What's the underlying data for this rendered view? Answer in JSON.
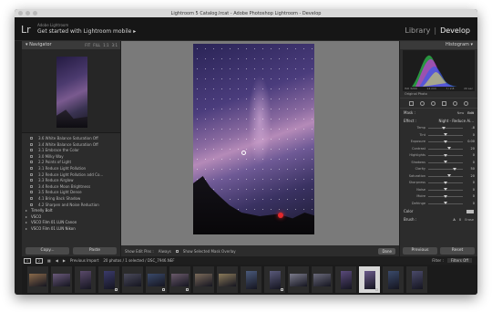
{
  "window": {
    "title": "Lightroom 5 Catalog.lrcat - Adobe Photoshop Lightroom - Develop"
  },
  "identity": {
    "small": "Adobe Lightroom",
    "main": "Get started with Lightroom mobile  ▸"
  },
  "modules": [
    "Library",
    "|",
    "Develop"
  ],
  "navigator": {
    "title": "Navigator",
    "zoom": [
      "FIT",
      "FILL",
      "1:1",
      "3:1"
    ]
  },
  "history": [
    {
      "label": "3.6 White Balance Saturation Off"
    },
    {
      "label": "3.4 White Balance Saturation Off"
    },
    {
      "label": "3.1 Embrace the Color"
    },
    {
      "label": "3.0 Milky Way"
    },
    {
      "label": "2.2 Points of Light"
    },
    {
      "label": "3.1 Reduce Light Pollution"
    },
    {
      "label": "3.2 Reduce Light Pollution add Co..."
    },
    {
      "label": "3.3 Reduce Airglow"
    },
    {
      "label": "3.4 Reduce Moon Brightness"
    },
    {
      "label": "3.5 Reduce Light Dense"
    },
    {
      "label": "4.1 Bring Back Shadow"
    },
    {
      "label": "4.2 Sharpen and Noise Reduction"
    }
  ],
  "collections": [
    "Timelly Bolt",
    "VSCO",
    "VSCO Film 01 LUN Canon",
    "VSCO Film 01 LUN Nikon"
  ],
  "left_buttons": {
    "copy": "Copy...",
    "paste": "Paste"
  },
  "toolbar": {
    "show_edit_pins": "Show Edit Pins :",
    "pins_value": "Always",
    "show_overlay": "Show Selected Mask Overlay",
    "done": "Done"
  },
  "histogram": {
    "title": "Histogram",
    "values": [
      "ISO 3200",
      "14 mm",
      "f / 2.8",
      "20 sec"
    ],
    "original_photo": "Original Photo"
  },
  "basic": {
    "mask": "Mask :",
    "new": "New",
    "edit": "Edit",
    "effect": "Effect :",
    "effect_value": "Night - Reduce Ai...",
    "sliders": [
      {
        "label": "Temp",
        "value": "-8",
        "pos": 0.45
      },
      {
        "label": "Tint",
        "value": "0",
        "pos": 0.5
      },
      {
        "label": "Exposure",
        "value": "0.00",
        "pos": 0.5
      },
      {
        "label": "Contrast",
        "value": "20",
        "pos": 0.6
      },
      {
        "label": "Highlights",
        "value": "0",
        "pos": 0.5
      },
      {
        "label": "Shadows",
        "value": "0",
        "pos": 0.5
      },
      {
        "label": "Clarity",
        "value": "50",
        "pos": 0.75
      },
      {
        "label": "Saturation",
        "value": "20",
        "pos": 0.6
      },
      {
        "label": "Sharpness",
        "value": "0",
        "pos": 0.5
      },
      {
        "label": "Noise",
        "value": "0",
        "pos": 0.5
      },
      {
        "label": "Moire",
        "value": "0",
        "pos": 0.5
      },
      {
        "label": "Defringe",
        "value": "0",
        "pos": 0.5
      }
    ],
    "color": "Color",
    "brush": "Brush :",
    "brush_a": "A",
    "brush_b": "B",
    "brush_erase": "Erase"
  },
  "right_buttons": {
    "previous": "Previous",
    "reset": "Reset"
  },
  "filmstrip": {
    "page1": "1",
    "page2": "2",
    "source": "Previous Import",
    "count": "20 photos / 1 selected / DSC_7946.NEF",
    "filter_label": "Filter :",
    "filter_value": "Filters Off",
    "cells": [
      {
        "tone": "#8a6a4a",
        "v": false,
        "edit": false
      },
      {
        "tone": "#6a5a7a",
        "v": false,
        "edit": false
      },
      {
        "tone": "#5a4a6a",
        "v": true,
        "edit": false
      },
      {
        "tone": "#3a3a6a",
        "v": true,
        "edit": true
      },
      {
        "tone": "#4a4a5a",
        "v": false,
        "edit": false
      },
      {
        "tone": "#3a4a6a",
        "v": false,
        "edit": true
      },
      {
        "tone": "#6a5a6a",
        "v": false,
        "edit": true
      },
      {
        "tone": "#7a6a5a",
        "v": false,
        "edit": false
      },
      {
        "tone": "#8a7a5a",
        "v": false,
        "edit": false
      },
      {
        "tone": "#4a5a7a",
        "v": true,
        "edit": false
      },
      {
        "tone": "#5a5a7a",
        "v": true,
        "edit": true
      },
      {
        "tone": "#7a7a8a",
        "v": false,
        "edit": false
      },
      {
        "tone": "#6a6a7a",
        "v": false,
        "edit": false
      },
      {
        "tone": "#5a4a7a",
        "v": true,
        "edit": false
      },
      {
        "tone": "#6a5a8a",
        "v": true,
        "edit": true,
        "selected": true
      },
      {
        "tone": "#3a4a6a",
        "v": true,
        "edit": false
      },
      {
        "tone": "#4a4a6a",
        "v": true,
        "edit": false
      }
    ]
  },
  "colors": {
    "accent": "#e3282c",
    "panel": "#2c2c2c",
    "center_bg": "#7a7a7a"
  }
}
